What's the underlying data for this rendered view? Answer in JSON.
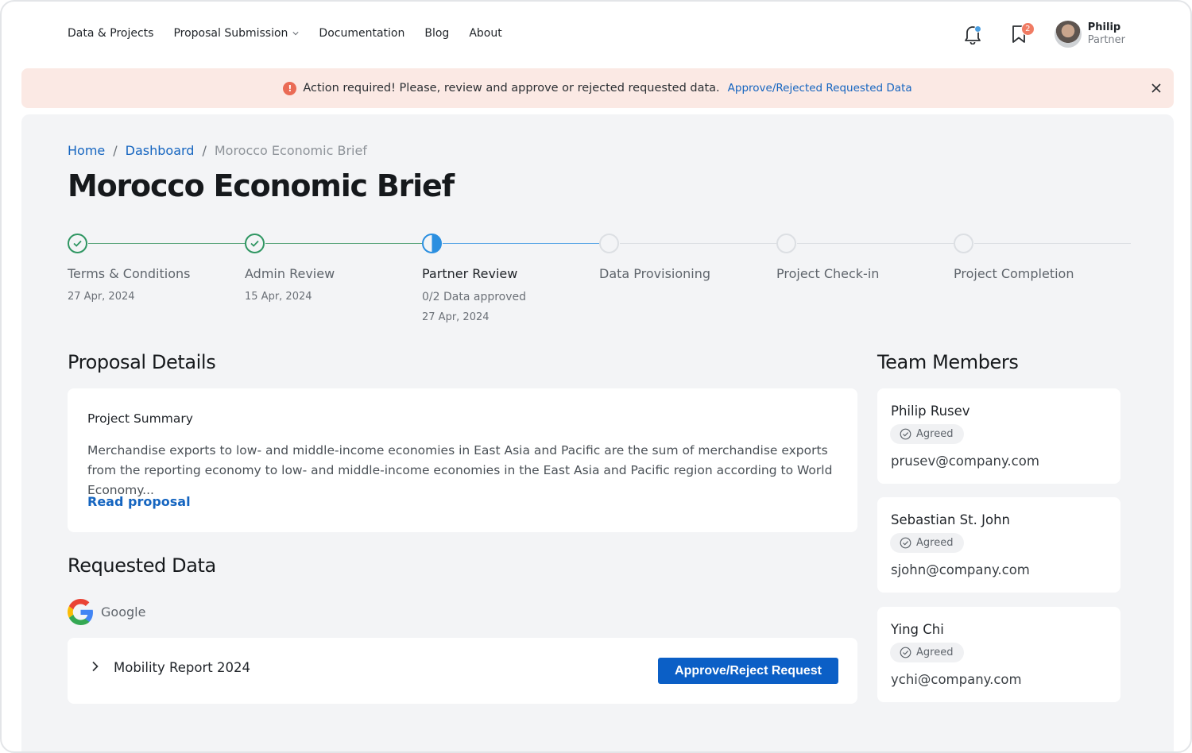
{
  "nav": {
    "links": [
      "Data & Projects",
      "Proposal Submission",
      "Documentation",
      "Blog",
      "About"
    ],
    "bookmark_badge": "2",
    "user": {
      "name": "Philip",
      "role": "Partner"
    }
  },
  "alert": {
    "icon": "!",
    "text": "Action required! Please, review and approve or rejected requested data.",
    "link": "Approve/Rejected Requested Data"
  },
  "breadcrumb": {
    "home": "Home",
    "dashboard": "Dashboard",
    "current": "Morocco Economic Brief"
  },
  "page_title": "Morocco Economic Brief",
  "stepper": [
    {
      "label": "Terms & Conditions",
      "date": "27 Apr, 2024",
      "status": "done"
    },
    {
      "label": "Admin Review",
      "date": "15 Apr, 2024",
      "status": "done"
    },
    {
      "label": "Partner Review",
      "sub": "0/2 Data approved",
      "date": "27 Apr, 2024",
      "status": "active"
    },
    {
      "label": "Data Provisioning",
      "status": "pending"
    },
    {
      "label": "Project Check-in",
      "status": "pending"
    },
    {
      "label": "Project Completion",
      "status": "pending"
    }
  ],
  "proposal": {
    "section_title": "Proposal Details",
    "summary_title": "Project Summary",
    "summary_text": "Merchandise exports to low- and middle-income economies in East Asia and Pacific are the sum of merchandise exports from the reporting economy to low- and middle-income economies in the East Asia and Pacific region according to World Economy...",
    "read_link": "Read proposal"
  },
  "requested": {
    "section_title": "Requested Data",
    "provider": "Google",
    "item_name": "Mobility Report 2024",
    "button": "Approve/Reject Request"
  },
  "team": {
    "section_title": "Team Members",
    "members": [
      {
        "name": "Philip Rusev",
        "status": "Agreed",
        "email": "prusev@company.com"
      },
      {
        "name": "Sebastian St. John",
        "status": "Agreed",
        "email": "sjohn@company.com"
      },
      {
        "name": "Ying Chi",
        "status": "Agreed",
        "email": "ychi@company.com"
      }
    ]
  },
  "colors": {
    "primary": "#0b5fc6",
    "link": "#1565c0",
    "success": "#2f9662",
    "active": "#2b8fe0",
    "alert_bg": "#fbe9e4",
    "alert_icon": "#ea6b55"
  }
}
